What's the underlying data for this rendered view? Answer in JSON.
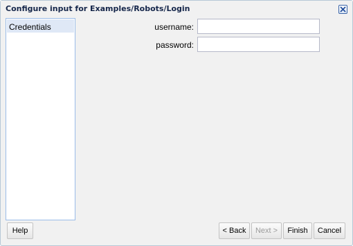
{
  "dialog": {
    "title": "Configure input for Examples/Robots/Login",
    "close_icon": "close-icon"
  },
  "nav": {
    "items": [
      {
        "label": "Credentials",
        "selected": true
      }
    ]
  },
  "form": {
    "username": {
      "label": "username:",
      "value": ""
    },
    "password": {
      "label": "password:",
      "value": ""
    }
  },
  "buttons": {
    "help": "Help",
    "back": "< Back",
    "next": "Next >",
    "finish": "Finish",
    "cancel": "Cancel"
  },
  "colors": {
    "selection": "#dfe8f6",
    "border": "#99bbe8",
    "title": "#15264a",
    "close": "#3a64a8"
  }
}
